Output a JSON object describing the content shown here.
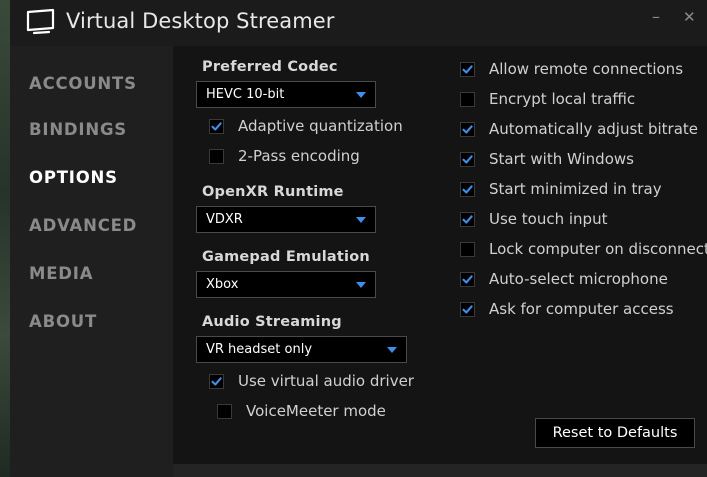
{
  "window": {
    "title": "Virtual Desktop Streamer",
    "minimize_glyph": "–",
    "close_glyph": "✕"
  },
  "sidebar": {
    "items": [
      {
        "label": "ACCOUNTS",
        "active": false
      },
      {
        "label": "BINDINGS",
        "active": false
      },
      {
        "label": "OPTIONS",
        "active": true
      },
      {
        "label": "ADVANCED",
        "active": false
      },
      {
        "label": "MEDIA",
        "active": false
      },
      {
        "label": "ABOUT",
        "active": false
      }
    ]
  },
  "options": {
    "codec": {
      "label": "Preferred Codec",
      "value": "HEVC 10-bit"
    },
    "adaptive_quantization": {
      "label": "Adaptive quantization",
      "checked": true
    },
    "two_pass": {
      "label": "2-Pass encoding",
      "checked": false
    },
    "openxr": {
      "label": "OpenXR Runtime",
      "value": "VDXR"
    },
    "gamepad": {
      "label": "Gamepad Emulation",
      "value": "Xbox"
    },
    "audio": {
      "label": "Audio Streaming",
      "value": "VR headset only"
    },
    "virtual_audio": {
      "label": "Use virtual audio driver",
      "checked": true
    },
    "voicemeeter": {
      "label": "VoiceMeeter mode",
      "checked": false
    },
    "right_checks": [
      {
        "label": "Allow remote connections",
        "checked": true
      },
      {
        "label": "Encrypt local traffic",
        "checked": false
      },
      {
        "label": "Automatically adjust bitrate",
        "checked": true
      },
      {
        "label": "Start with Windows",
        "checked": true
      },
      {
        "label": "Start minimized in tray",
        "checked": true
      },
      {
        "label": "Use touch input",
        "checked": true
      },
      {
        "label": "Lock computer on disconnect",
        "checked": false
      },
      {
        "label": "Auto-select microphone",
        "checked": true
      },
      {
        "label": "Ask for computer access",
        "checked": true
      }
    ],
    "reset_label": "Reset to Defaults"
  },
  "icons": {
    "app": "monitor-icon",
    "dropdown": "chevron-down-icon",
    "check": "checkmark-icon"
  },
  "colors": {
    "accent": "#3f8fe8",
    "sidebar_bg": "#1f1f1f",
    "content_bg": "#141414",
    "text_active": "#ffffff",
    "text_inactive": "#8a8a8a"
  }
}
